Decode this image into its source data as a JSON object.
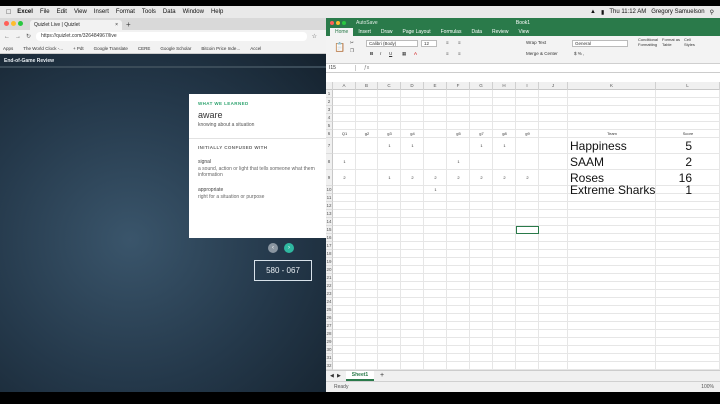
{
  "menubar": {
    "apple": "",
    "app": "Excel",
    "items": [
      "File",
      "Edit",
      "View",
      "Insert",
      "Format",
      "Tools",
      "Data",
      "Window",
      "Help"
    ],
    "clock": "Thu 11:12 AM",
    "user": "Gregory Samuelson"
  },
  "browser": {
    "tab_title": "Quizlet Live | Quizlet",
    "url": "https://quizlet.com/326484967/live",
    "bookmarks": [
      "Apps",
      "The World Clock -...",
      "+ Pdt",
      "Google Translate",
      "CERE",
      "Google Scholar",
      "Bitcoin Price Inde...",
      "Accel"
    ]
  },
  "quizlet": {
    "header": "End-of-Game Review",
    "what_we_learned_label": "WHAT WE LEARNED",
    "term": "aware",
    "definition": "knowing about a situation",
    "confused_label": "INITIALLY CONFUSED WITH",
    "confused": [
      {
        "term": "signal",
        "definition": "a sound, action or light that tells someone what them information"
      },
      {
        "term": "appropriate",
        "definition": "right for a situation or purpose"
      }
    ],
    "code": "580 - 067"
  },
  "excel": {
    "title": "Book1",
    "quick_access": "AutoSave",
    "ribbon_tabs": [
      "Home",
      "Insert",
      "Draw",
      "Page Layout",
      "Formulas",
      "Data",
      "Review",
      "View"
    ],
    "active_tab": "Home",
    "font_name": "Calibri (Body)",
    "font_size": "12",
    "number_format": "General",
    "wrap_text": "Wrap Text",
    "merge_center": "Merge & Center",
    "conditional_formatting": "Conditional Formatting",
    "format_as_table": "Format as Table",
    "cell_styles": "Cell Styles",
    "name_box": "I15",
    "columns": [
      "A",
      "B",
      "C",
      "D",
      "E",
      "F",
      "G",
      "H",
      "I",
      "J",
      "K",
      "L"
    ],
    "rows": [
      "1",
      "2",
      "3",
      "4",
      "5",
      "6",
      "7",
      "8",
      "9",
      "10",
      "11",
      "12",
      "13",
      "14",
      "15",
      "16",
      "17",
      "18",
      "19",
      "20",
      "21",
      "22",
      "23",
      "24",
      "25",
      "26",
      "27",
      "28",
      "29",
      "30",
      "31",
      "32",
      "33",
      "34",
      "35",
      "36"
    ],
    "header_row": {
      "A": "Q1",
      "B": "g2",
      "C": "g3",
      "D": "g4",
      "F": "g5",
      "G": "g7",
      "H": "g8",
      "I": "g9",
      "K": "Team",
      "L": "Score"
    },
    "small_values": [
      {
        "r": 7,
        "col": "C",
        "v": "1"
      },
      {
        "r": 7,
        "col": "D",
        "v": "1"
      },
      {
        "r": 7,
        "col": "G",
        "v": "1"
      },
      {
        "r": 7,
        "col": "H",
        "v": "1"
      },
      {
        "r": 8,
        "col": "A",
        "v": "1"
      },
      {
        "r": 8,
        "col": "F",
        "v": "1"
      },
      {
        "r": 9,
        "col": "A",
        "v": "2"
      },
      {
        "r": 9,
        "col": "C",
        "v": "1"
      },
      {
        "r": 9,
        "col": "D",
        "v": "2"
      },
      {
        "r": 9,
        "col": "E",
        "v": "2"
      },
      {
        "r": 9,
        "col": "F",
        "v": "2"
      },
      {
        "r": 9,
        "col": "G",
        "v": "2"
      },
      {
        "r": 9,
        "col": "H",
        "v": "2"
      },
      {
        "r": 9,
        "col": "I",
        "v": "2"
      },
      {
        "r": 10,
        "col": "E",
        "v": "1"
      }
    ],
    "teams": [
      {
        "name": "Happiness",
        "score": "5"
      },
      {
        "name": "SAAM",
        "score": "2"
      },
      {
        "name": "Roses",
        "score": "16"
      },
      {
        "name": "Extreme Sharks",
        "score": "1"
      }
    ],
    "sheet_tab": "Sheet1",
    "add_sheet": "+",
    "status": "Ready",
    "zoom": "100%",
    "colors": {
      "excel_green": "#2a7a4a",
      "quizlet_green": "#2fa36f"
    }
  }
}
